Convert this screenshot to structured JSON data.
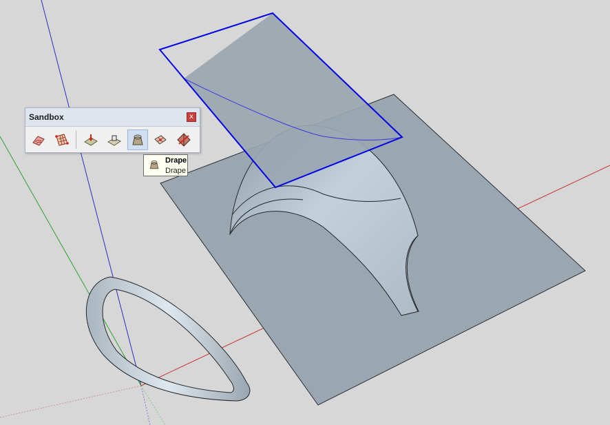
{
  "toolbar": {
    "title": "Sandbox",
    "close_label": "x",
    "tools": [
      {
        "name": "from-contours"
      },
      {
        "name": "from-scratch"
      },
      {
        "name": "smoove"
      },
      {
        "name": "stamp"
      },
      {
        "name": "drape",
        "active": true
      },
      {
        "name": "add-detail"
      },
      {
        "name": "flip-edge"
      }
    ]
  },
  "tooltip": {
    "title": "Drape",
    "description": "Drape",
    "icon": "drape-icon"
  },
  "colors": {
    "background": "#d7d7d7",
    "surface": "#9aa6b0",
    "selection": "#0000e6",
    "axis_red": "#c83232",
    "axis_green": "#2ea02e",
    "axis_blue": "#2a2ac8"
  }
}
